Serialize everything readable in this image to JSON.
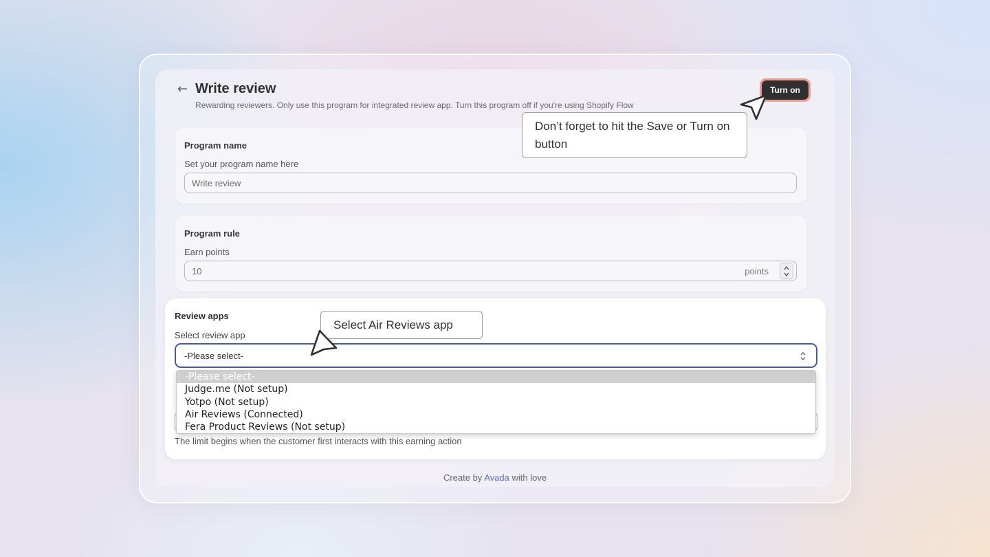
{
  "header": {
    "back_icon": "arrow-left-icon",
    "title": "Write review",
    "subtitle": "Rewarding reviewers. Only use this program for integrated review app. Turn this program off if you're using Shopify Flow",
    "turn_on_label": "Turn on"
  },
  "program_name_card": {
    "title": "Program name",
    "label": "Set your program name here",
    "value": "Write review"
  },
  "program_rule_card": {
    "title": "Program rule",
    "label": "Earn points",
    "value": "10",
    "suffix": "points"
  },
  "review_apps_card": {
    "title": "Review apps",
    "label": "Select review app",
    "selected_value": "-Please select-",
    "options": [
      "-Please select-",
      "Judge.me (Not setup)",
      "Yotpo (Not setup)",
      "Air Reviews (Connected)",
      "Fera Product Reviews (Not setup)"
    ],
    "limit_hint": "The limit begins when the customer first interacts with this earning action"
  },
  "footer": {
    "prefix": "Create by",
    "brand": "Avada",
    "suffix": "with love"
  },
  "callouts": {
    "save_hint": "Don’t forget to hit the Save or Turn on button",
    "air_hint": "Select Air Reviews app"
  },
  "colors": {
    "primary_button": "#303030",
    "button_highlight": "#f19c92",
    "focus_border": "#3c5ab7",
    "brand_link": "#5b6fcf"
  }
}
